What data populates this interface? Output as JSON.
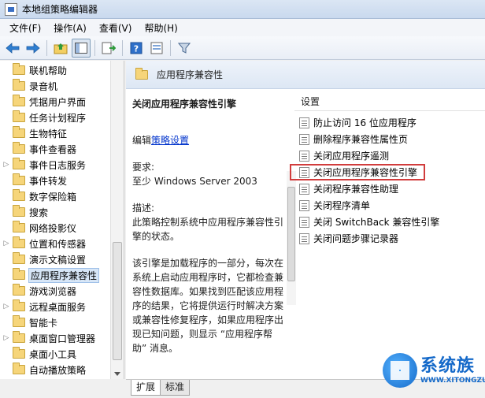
{
  "window": {
    "title": "本地组策略编辑器"
  },
  "menu": [
    "文件(F)",
    "操作(A)",
    "查看(V)",
    "帮助(H)"
  ],
  "toolbar": {
    "icons": [
      "back-arrow-icon",
      "forward-arrow-icon",
      "up-folder-icon",
      "show-hide-tree-icon",
      "export-list-icon",
      "help-icon",
      "properties-icon",
      "filter-icon"
    ]
  },
  "tree": {
    "items": [
      {
        "label": "联机帮助",
        "expandable": false
      },
      {
        "label": "录音机",
        "expandable": false
      },
      {
        "label": "凭据用户界面",
        "expandable": false
      },
      {
        "label": "任务计划程序",
        "expandable": false
      },
      {
        "label": "生物特征",
        "expandable": false
      },
      {
        "label": "事件查看器",
        "expandable": false
      },
      {
        "label": "事件日志服务",
        "expandable": true
      },
      {
        "label": "事件转发",
        "expandable": false
      },
      {
        "label": "数字保险箱",
        "expandable": false
      },
      {
        "label": "搜索",
        "expandable": false
      },
      {
        "label": "网络投影仪",
        "expandable": false
      },
      {
        "label": "位置和传感器",
        "expandable": true
      },
      {
        "label": "演示文稿设置",
        "expandable": false
      },
      {
        "label": "应用程序兼容性",
        "expandable": false,
        "selected": true
      },
      {
        "label": "游戏浏览器",
        "expandable": false
      },
      {
        "label": "远程桌面服务",
        "expandable": true
      },
      {
        "label": "智能卡",
        "expandable": false
      },
      {
        "label": "桌面窗口管理器",
        "expandable": true
      },
      {
        "label": "桌面小工具",
        "expandable": false
      },
      {
        "label": "自动播放策略",
        "expandable": false
      }
    ]
  },
  "right": {
    "header": "应用程序兼容性",
    "description": {
      "title": "关闭应用程序兼容性引擎",
      "edit_prefix": "编辑",
      "edit_link": "策略设置",
      "req_label": "要求:",
      "req_value": "至少 Windows Server 2003",
      "desc_label": "描述:",
      "desc_text": "此策略控制系统中应用程序兼容性引擎的状态。",
      "detail": "该引擎是加载程序的一部分，每次在系统上启动应用程序时，它都检查兼容性数据库。如果找到匹配该应用程序的结果，它将提供运行时解决方案或兼容性修复程序，如果应用程序出现已知问题，则显示 “应用程序帮助” 消息。"
    },
    "settings": {
      "header": "设置",
      "items": [
        "防止访问 16 位应用程序",
        "删除程序兼容性属性页",
        "关闭应用程序遥测",
        "关闭应用程序兼容性引擎",
        "关闭程序兼容性助理",
        "关闭程序清单",
        "关闭 SwitchBack 兼容性引擎",
        "关闭问题步骤记录器"
      ]
    }
  },
  "tabs": [
    "扩展",
    "标准"
  ],
  "watermark": {
    "name": "系统族",
    "url": "WWW.XITONGZU.COM"
  }
}
